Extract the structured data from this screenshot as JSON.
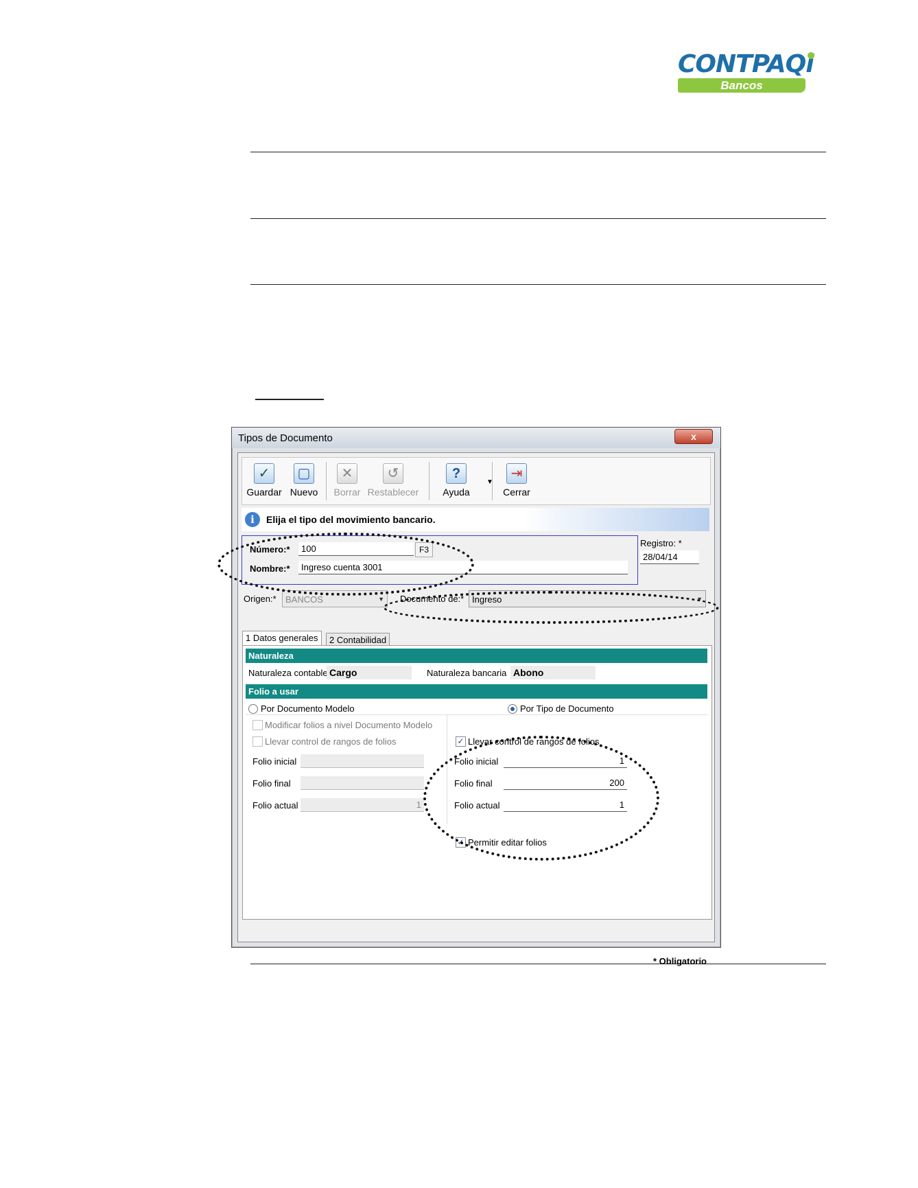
{
  "logo": {
    "brand": "CONTPAQ",
    "brand_letter": "i",
    "product": "Bancos"
  },
  "dialog": {
    "title": "Tipos de Documento",
    "close_glyph": "x",
    "toolbar": {
      "guardar": "Guardar",
      "nuevo": "Nuevo",
      "borrar": "Borrar",
      "restablecer": "Restablecer",
      "ayuda": "Ayuda",
      "cerrar": "Cerrar"
    },
    "info": "Elija el tipo del movimiento bancario.",
    "numero": {
      "label": "Número:*",
      "value": "100",
      "key_hint": "F3"
    },
    "nombre": {
      "label": "Nombre:*",
      "value": "Ingreso cuenta 3001"
    },
    "registro": {
      "label": "Registro: *",
      "value": "28/04/14"
    },
    "origen": {
      "label": "Origen:*",
      "value": "BANCOS"
    },
    "documento_de": {
      "label": "Documento de:*",
      "value": "Ingreso"
    },
    "tabs": [
      {
        "label": "1 Datos generales"
      },
      {
        "label": "2 Contabilidad"
      }
    ],
    "naturaleza": {
      "header": "Naturaleza",
      "contable_label": "Naturaleza contable",
      "contable_value": "Cargo",
      "bancaria_label": "Naturaleza bancaria",
      "bancaria_value": "Abono"
    },
    "folio": {
      "header": "Folio a usar",
      "por_documento_modelo": "Por Documento Modelo",
      "por_tipo_documento": "Por Tipo de Documento",
      "modificar_folios": "Modificar folios a nivel Documento Modelo",
      "llevar_control_left": "Llevar control de rangos de folios",
      "llevar_control_right": "Llevar control de rangos de folios",
      "folio_inicial_label": "Folio inicial",
      "folio_final_label": "Folio final",
      "folio_actual_label": "Folio actual",
      "left_inicial": "",
      "left_final": "",
      "left_actual": "1",
      "right_inicial": "1",
      "right_final": "200",
      "right_actual": "1",
      "permitir_editar": "Permitir editar folios"
    },
    "obligatorio": "* Obligatorio"
  }
}
